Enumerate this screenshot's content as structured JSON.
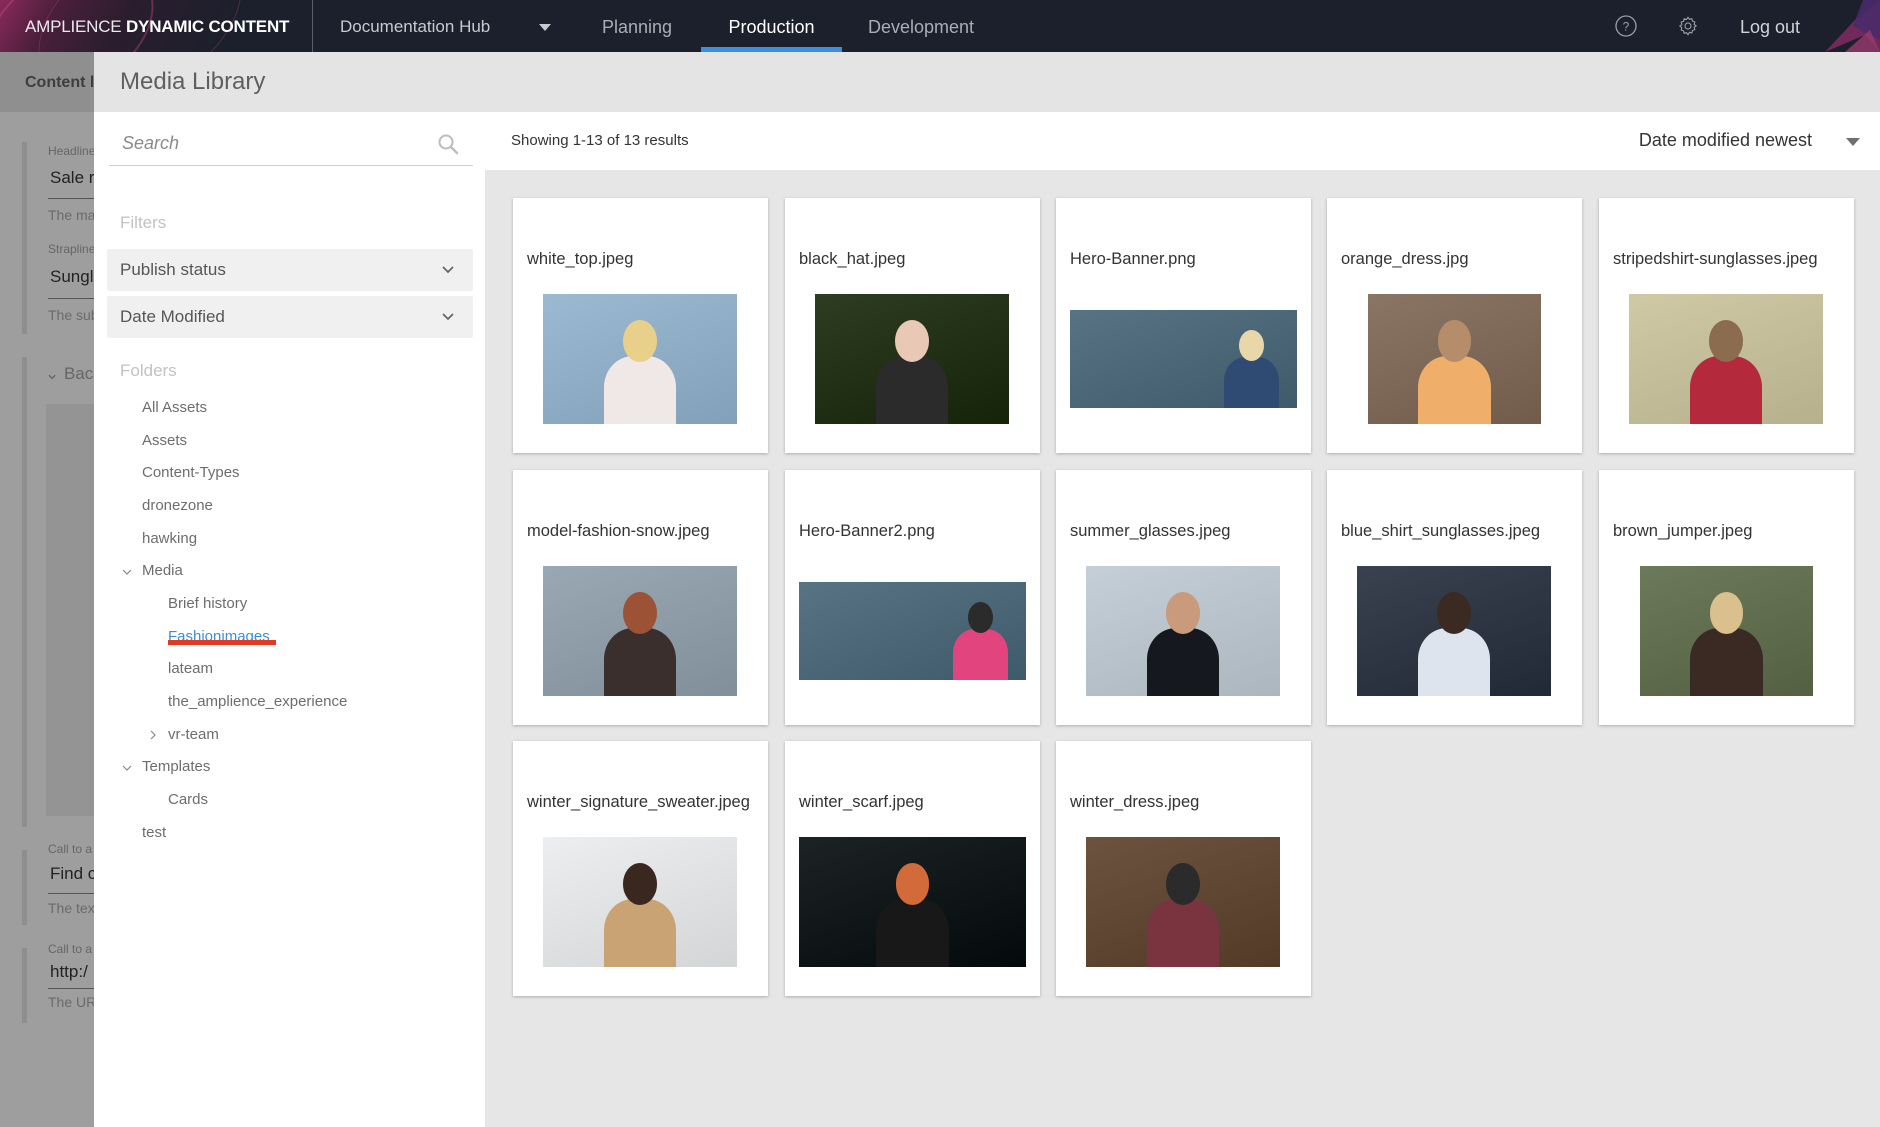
{
  "topbar": {
    "brand_light": "AMPLIENCE ",
    "brand_bold": "DYNAMIC CONTENT",
    "hub": "Documentation Hub",
    "tabs": [
      {
        "label": "Planning",
        "active": false
      },
      {
        "label": "Production",
        "active": true
      },
      {
        "label": "Development",
        "active": false
      }
    ],
    "help_icon": "help-circle-icon",
    "settings_icon": "gear-icon",
    "logout": "Log out"
  },
  "background_page": {
    "breadcrumb": "Content l",
    "fields": [
      {
        "label": "Headline",
        "value": "Sale r",
        "help": "The ma"
      },
      {
        "label": "Strapline",
        "value": "Sungl",
        "help": "The sub"
      },
      {
        "label": "Call to a",
        "value": "Find c",
        "help": "The tex"
      },
      {
        "label": "Call to a",
        "value": "http:/",
        "help": "The UR"
      }
    ],
    "section": "Bac"
  },
  "modal": {
    "title": "Media Library",
    "search": {
      "placeholder": "Search",
      "value": ""
    },
    "filters_label": "Filters",
    "filters": [
      "Publish status",
      "Date Modified"
    ],
    "folders_label": "Folders",
    "folders": [
      {
        "label": "All Assets",
        "level": 0
      },
      {
        "label": "Assets",
        "level": 0
      },
      {
        "label": "Content-Types",
        "level": 0
      },
      {
        "label": "dronezone",
        "level": 0
      },
      {
        "label": "hawking",
        "level": 0
      },
      {
        "label": "Media",
        "level": 0,
        "expanded": true
      },
      {
        "label": "Brief history",
        "level": 1
      },
      {
        "label": "Fashionimages",
        "level": 1,
        "selected": true
      },
      {
        "label": "lateam",
        "level": 1
      },
      {
        "label": "the_amplience_experience",
        "level": 1
      },
      {
        "label": "vr-team",
        "level": 1,
        "expanded": false
      },
      {
        "label": "Templates",
        "level": 0,
        "expanded": true
      },
      {
        "label": "Cards",
        "level": 1
      },
      {
        "label": "test",
        "level": 0
      }
    ],
    "results": "Showing 1-13 of 13 results",
    "sort": "Date modified newest",
    "assets": [
      {
        "name": "white_top.jpeg",
        "shape": "normal",
        "colors": [
          "#9cb9d2",
          "#f0e8e6",
          "#e8d08a"
        ]
      },
      {
        "name": "black_hat.jpeg",
        "shape": "normal",
        "colors": [
          "#2e3d22",
          "#2b2b2b",
          "#e9c8b6"
        ]
      },
      {
        "name": "Hero-Banner.png",
        "shape": "wide",
        "colors": [
          "#587383",
          "#2f4a73",
          "#e9d7a9"
        ]
      },
      {
        "name": "orange_dress.jpg",
        "shape": "narrow",
        "colors": [
          "#8a7565",
          "#efae6a",
          "#b58d6a"
        ]
      },
      {
        "name": "stripedshirt-sunglasses.jpeg",
        "shape": "normal",
        "colors": [
          "#cfc9a6",
          "#b42a3c",
          "#8c6c4e"
        ]
      },
      {
        "name": "model-fashion-snow.jpeg",
        "shape": "normal",
        "colors": [
          "#9aa8b3",
          "#3a2f2c",
          "#9c5234"
        ]
      },
      {
        "name": "Hero-Banner2.png",
        "shape": "wide",
        "colors": [
          "#587383",
          "#e2447e",
          "#2b2b2b"
        ]
      },
      {
        "name": "summer_glasses.jpeg",
        "shape": "normal",
        "colors": [
          "#c5cfd8",
          "#16181f",
          "#c99a7c"
        ]
      },
      {
        "name": "blue_shirt_sunglasses.jpeg",
        "shape": "normal",
        "colors": [
          "#3a4250",
          "#dde4ee",
          "#3b2a22"
        ]
      },
      {
        "name": "brown_jumper.jpeg",
        "shape": "narrow",
        "colors": [
          "#6c7a5b",
          "#3b2a24",
          "#d9c08d"
        ]
      },
      {
        "name": "winter_signature_sweater.jpeg",
        "shape": "normal",
        "colors": [
          "#eceeef",
          "#c9a374",
          "#3a2720"
        ]
      },
      {
        "name": "winter_scarf.jpeg",
        "shape": "wide-tall",
        "colors": [
          "#1c2324",
          "#181818",
          "#d26a3a"
        ]
      },
      {
        "name": "winter_dress.jpeg",
        "shape": "normal",
        "colors": [
          "#6b5340",
          "#7a3440",
          "#2b2b2b"
        ]
      }
    ]
  },
  "colors": {
    "topbar_bg": "#1b202c",
    "accent": "#3c8fdc",
    "selected_folder": "#3b8fd6",
    "highlight_underline": "#e23a22"
  }
}
